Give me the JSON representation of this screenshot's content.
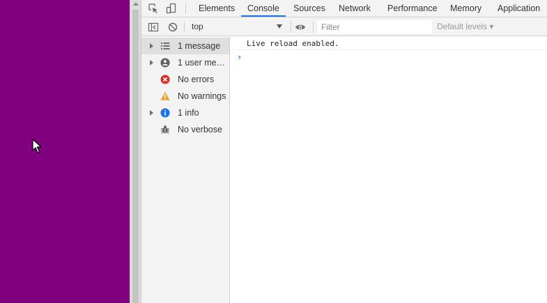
{
  "page": {
    "background_color": "#800080"
  },
  "devtools": {
    "toolbar_icons": [
      "inspect-element-icon",
      "device-toolbar-icon"
    ],
    "tabs": [
      {
        "label": "Elements",
        "active": false
      },
      {
        "label": "Console",
        "active": true
      },
      {
        "label": "Sources",
        "active": false
      },
      {
        "label": "Network",
        "active": false
      },
      {
        "label": "Performance",
        "active": false
      },
      {
        "label": "Memory",
        "active": false
      },
      {
        "label": "Application",
        "active": false
      }
    ],
    "accent_color": "#1a73e8"
  },
  "console_toolbar": {
    "context": "top",
    "filter_placeholder": "Filter",
    "filter_value": "",
    "levels": "Default levels ▾"
  },
  "sidebar": {
    "items": [
      {
        "label": "1 message",
        "icon": "list-icon",
        "expandable": true,
        "selected": true
      },
      {
        "label": "1 user mess...",
        "icon": "user-icon",
        "expandable": true,
        "selected": false
      },
      {
        "label": "No errors",
        "icon": "error-icon",
        "expandable": false,
        "selected": false
      },
      {
        "label": "No warnings",
        "icon": "warning-icon",
        "expandable": false,
        "selected": false
      },
      {
        "label": "1 info",
        "icon": "info-icon",
        "expandable": true,
        "selected": false
      },
      {
        "label": "No verbose",
        "icon": "bug-icon",
        "expandable": false,
        "selected": false
      }
    ]
  },
  "console": {
    "messages": [
      "Live reload enabled."
    ],
    "prompt": "›"
  }
}
